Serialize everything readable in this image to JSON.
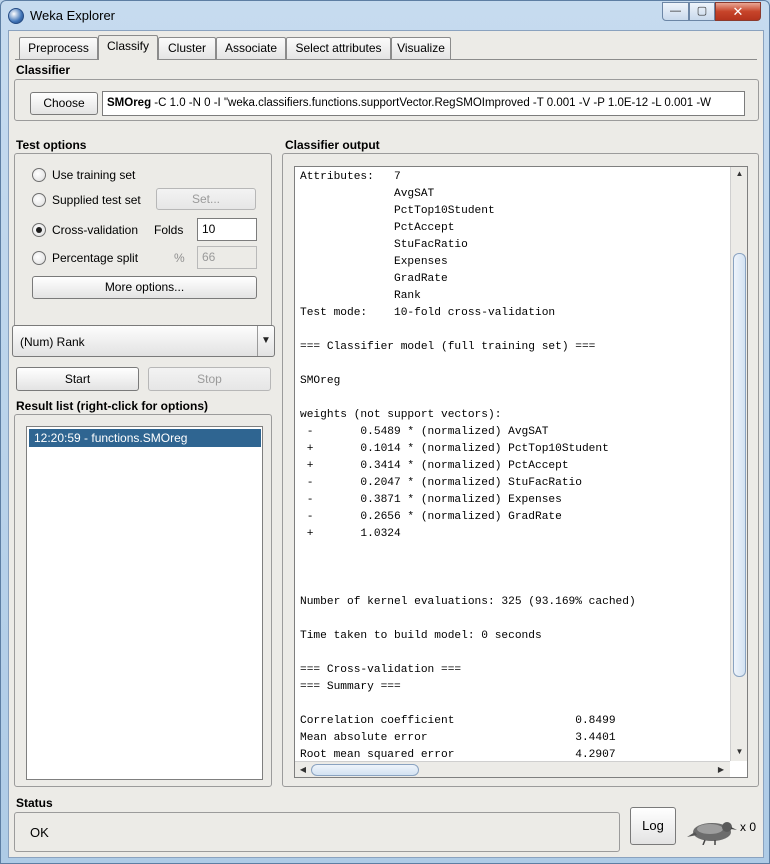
{
  "window": {
    "title": "Weka Explorer",
    "min": "—",
    "max": "▢",
    "close": "✕"
  },
  "tabs": [
    {
      "label": "Preprocess"
    },
    {
      "label": "Classify"
    },
    {
      "label": "Cluster"
    },
    {
      "label": "Associate"
    },
    {
      "label": "Select attributes"
    },
    {
      "label": "Visualize"
    }
  ],
  "classifier": {
    "section_label": "Classifier",
    "choose_label": "Choose",
    "name": "SMOreg",
    "options": " -C 1.0 -N 0 -I \"weka.classifiers.functions.supportVector.RegSMOImproved -T 0.001 -V -P 1.0E-12 -L 0.001 -W"
  },
  "test_options": {
    "section_label": "Test options",
    "use_training_set": "Use training set",
    "supplied_test_set": "Supplied test set",
    "set_button": "Set...",
    "cross_validation": "Cross-validation",
    "folds_label": "Folds",
    "folds_value": "10",
    "percentage_split": "Percentage split",
    "percent_symbol": "%",
    "percentage_value": "66",
    "more_options": "More options..."
  },
  "target": {
    "selected": "(Num) Rank",
    "arrow": "▼"
  },
  "actions": {
    "start": "Start",
    "stop": "Stop"
  },
  "result_list": {
    "section_label": "Result list (right-click for options)",
    "items": [
      "12:20:59 - functions.SMOreg"
    ]
  },
  "output": {
    "section_label": "Classifier output",
    "lines": [
      "Attributes:   7",
      "              AvgSAT",
      "              PctTop10Student",
      "              PctAccept",
      "              StuFacRatio",
      "              Expenses",
      "              GradRate",
      "              Rank",
      "Test mode:    10-fold cross-validation",
      "",
      "=== Classifier model (full training set) ===",
      "",
      "SMOreg",
      "",
      "weights (not support vectors):",
      " -       0.5489 * (normalized) AvgSAT",
      " +       0.1014 * (normalized) PctTop10Student",
      " +       0.3414 * (normalized) PctAccept",
      " -       0.2047 * (normalized) StuFacRatio",
      " -       0.3871 * (normalized) Expenses",
      " -       0.2656 * (normalized) GradRate",
      " +       1.0324",
      "",
      "",
      "",
      "Number of kernel evaluations: 325 (93.169% cached)",
      "",
      "Time taken to build model: 0 seconds",
      "",
      "=== Cross-validation ===",
      "=== Summary ===",
      "",
      "Correlation coefficient                  0.8499",
      "Mean absolute error                      3.4401",
      "Root mean squared error                  4.2907"
    ],
    "scroll_up": "▲",
    "scroll_down": "▼",
    "scroll_left": "◀",
    "scroll_right": "▶"
  },
  "status": {
    "section_label": "Status",
    "text": "OK",
    "log_button": "Log",
    "task_count": "x 0"
  }
}
